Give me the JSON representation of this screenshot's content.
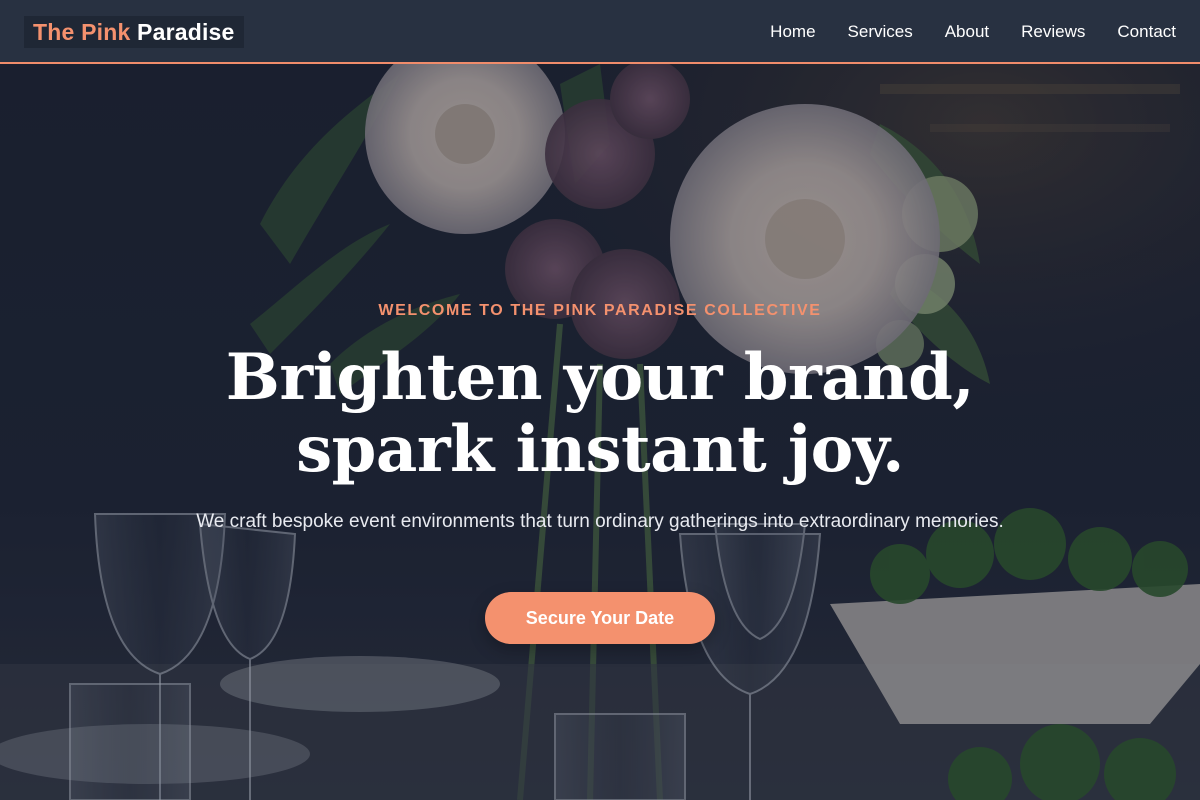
{
  "brand": {
    "accent_part": "The Pink",
    "rest_part": " Paradise"
  },
  "nav": {
    "items": [
      {
        "label": "Home"
      },
      {
        "label": "Services"
      },
      {
        "label": "About"
      },
      {
        "label": "Reviews"
      },
      {
        "label": "Contact"
      }
    ]
  },
  "hero": {
    "eyebrow": "Welcome to The Pink Paradise Collective",
    "headline_line1": "Brighten your brand,",
    "headline_line2": "spark instant joy.",
    "subtext": "We craft bespoke event environments that turn ordinary gatherings into extraordinary memories.",
    "cta_label": "Secure Your Date"
  },
  "colors": {
    "accent": "#f4916e",
    "nav_bg": "#283141",
    "hero_overlay": "#141a28"
  },
  "background_image": "dinner-table-with-flowers-and-glassware"
}
